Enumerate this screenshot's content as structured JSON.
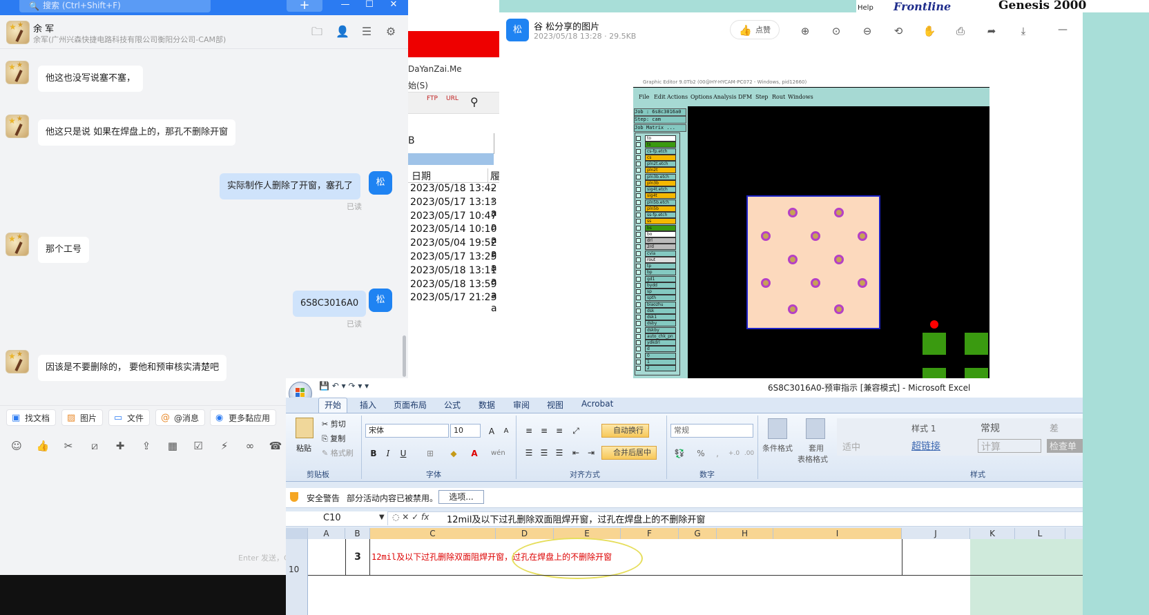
{
  "chat": {
    "search_placeholder": "搜索 (Ctrl+Shift+F)",
    "plus_label": "+",
    "contact_name": "余 军",
    "contact_sub": "余军(广州兴森快捷电路科技有限公司衡阳分公司-CAM部)",
    "messages": [
      {
        "side": "left",
        "text": "他这也没写说塞不塞，"
      },
      {
        "side": "left",
        "text": "他这只是说 如果在焊盘上的，那孔不删除开窗"
      },
      {
        "side": "right",
        "text": "实际制作人删除了开窗，塞孔了",
        "status": "已读"
      },
      {
        "side": "left",
        "text": "那个工号"
      },
      {
        "side": "right",
        "text": "6S8C3016A0",
        "status": "已读"
      },
      {
        "side": "left",
        "text": "因该是不要删除的， 要他和预审核实清楚吧"
      }
    ],
    "me_avatar": "松",
    "quick_buttons": [
      "找文档",
      "图片",
      "文件",
      "@消息",
      "更多黏应用"
    ],
    "enter_send": "Enter 发送，C"
  },
  "middle": {
    "url_text": "DaYanZai.Me",
    "menu_text": "始(S)",
    "toolbar_labels": [
      "FTP",
      "URL"
    ],
    "col_letter": "B",
    "header_date": "日期",
    "header_extra": "履",
    "dates": [
      "2023/05/18 13:42",
      "2023/05/17 13:13",
      "2023/05/17 10:47",
      "2023/05/14 10:10",
      "2023/05/04 19:52",
      "2023/05/17 13:25",
      "2023/05/18 13:11",
      "2023/05/18 13:59",
      "2023/05/17 21:23"
    ],
    "date_suffix": [
      "--",
      "-a",
      "-a",
      "-a",
      "-a",
      "-a",
      "-a",
      "-a",
      "-a"
    ]
  },
  "viewer": {
    "icon_label": "松",
    "title": "谷 松分享的图片",
    "meta": "2023/05/18 13:28 · 29.5KB",
    "like_label": "点赞",
    "minimize": "—"
  },
  "genesis": {
    "title_bar": "Graphic Editor 9.0Tb2 (00@HY-HYCAM-PC072 - Windows, pid12660)",
    "menu": [
      "File",
      "Edit",
      "Actions",
      "Options",
      "Analysis",
      "DFM",
      "Step",
      "Rout",
      "Windows"
    ],
    "job": "Job : 6s8c3016a0",
    "step": "Step: cam",
    "matrix": "Job Matrix ...",
    "layers": [
      {
        "name": "to",
        "color": "#ffffff"
      },
      {
        "name": "ts",
        "color": "#3a9a10"
      },
      {
        "name": "cs-fp.etch",
        "color": "#84c9c1"
      },
      {
        "name": "cs",
        "color": "#f5b800"
      },
      {
        "name": "pln2t.etch",
        "color": "#84c9c1"
      },
      {
        "name": "pln2t",
        "color": "#f5b800"
      },
      {
        "name": "pln3b.etch",
        "color": "#84c9c1"
      },
      {
        "name": "pln3b",
        "color": "#f5b800"
      },
      {
        "name": "sig4t.etch",
        "color": "#84c9c1"
      },
      {
        "name": "sig4t",
        "color": "#f5b800"
      },
      {
        "name": "pln5b.etch",
        "color": "#84c9c1"
      },
      {
        "name": "pln5b",
        "color": "#f5b800"
      },
      {
        "name": "ss-fp.etch",
        "color": "#84c9c1"
      },
      {
        "name": "ss",
        "color": "#f5b800"
      },
      {
        "name": "bs",
        "color": "#3a9a10"
      },
      {
        "name": "bo",
        "color": "#ffffff"
      },
      {
        "name": "drl",
        "color": "#bbbbbb"
      },
      {
        "name": "2rd",
        "color": "#bbbbbb"
      },
      {
        "name": "cvia",
        "color": "#84c9c1"
      },
      {
        "name": "rout",
        "color": "#dddddd"
      },
      {
        "name": "tp",
        "color": "#84c9c1"
      },
      {
        "name": "bp",
        "color": "#84c9c1"
      },
      {
        "name": "gd1",
        "color": "#84c9c1"
      },
      {
        "name": "bydd",
        "color": "#84c9c1"
      },
      {
        "name": "sp",
        "color": "#84c9c1"
      },
      {
        "name": "spth",
        "color": "#84c9c1"
      },
      {
        "name": "biaozhu",
        "color": "#84c9c1"
      },
      {
        "name": "dsk",
        "color": "#84c9c1"
      },
      {
        "name": "dsk1",
        "color": "#84c9c1"
      },
      {
        "name": "dsby",
        "color": "#84c9c1"
      },
      {
        "name": "dskby",
        "color": "#84c9c1"
      },
      {
        "name": "auto_chk_pn",
        "color": "#84c9c1"
      },
      {
        "name": "ydkdrl",
        "color": "#84c9c1"
      },
      {
        "name": "d",
        "color": "#84c9c1"
      },
      {
        "name": "0",
        "color": "#84c9c1"
      },
      {
        "name": "1",
        "color": "#84c9c1"
      },
      {
        "name": "2",
        "color": "#84c9c1"
      }
    ]
  },
  "frontline": {
    "help": "Help",
    "logo": "Frontline",
    "genesis": "Genesis 2000"
  },
  "excel": {
    "title": "6S8C3016A0-预审指示  [兼容模式] - Microsoft Excel",
    "tabs": [
      "开始",
      "插入",
      "页面布局",
      "公式",
      "数据",
      "审阅",
      "视图",
      "Acrobat"
    ],
    "clipboard": {
      "paste": "粘贴",
      "cut": "剪切",
      "copy": "复制",
      "format_painter": "格式刷",
      "group": "剪贴板"
    },
    "font": {
      "name": "宋体",
      "size": "10",
      "group": "字体",
      "bold": "B",
      "italic": "I",
      "underline": "U"
    },
    "align": {
      "wrap": "自动换行",
      "merge": "合并后居中",
      "group": "对齐方式"
    },
    "number": {
      "format": "常规",
      "group": "数字",
      "percent": "%"
    },
    "styles": {
      "cond": "条件格式",
      "table1": "套用",
      "table2": "表格格式",
      "style1": "样式 1",
      "normal": "常规",
      "bad": "差",
      "neutral": "适中",
      "hyperlink": "超链接",
      "calc": "计算",
      "check": "检查单",
      "group": "样式"
    },
    "warning": {
      "title": "安全警告",
      "text": "部分活动内容已被禁用。",
      "button": "选项..."
    },
    "name_box": "C10",
    "fx": "fx",
    "formula": "12mil及以下过孔删除双面阻焊开窗，过孔在焊盘上的不删除开窗",
    "columns": [
      "A",
      "B",
      "C",
      "D",
      "E",
      "F",
      "G",
      "H",
      "I",
      "J",
      "K",
      "L"
    ],
    "row_number": "10",
    "cell_b": "3",
    "cell_c_part1": "12mil及以下过孔删除双面阻焊开窗，",
    "cell_c_part2": "过孔在焊盘上的不删除开窗"
  }
}
